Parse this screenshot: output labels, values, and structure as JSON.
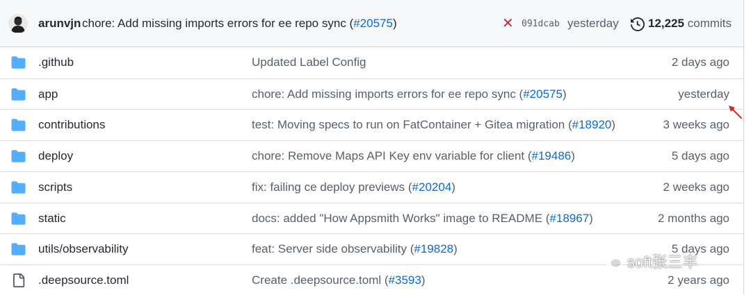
{
  "latest_commit": {
    "author": "arunvjn",
    "message": "chore: Add missing imports errors for ee repo sync (",
    "pr_link": "#20575",
    "message_close": ")",
    "status_icon": "x-icon",
    "status_symbol": "✕",
    "status_color": "#cf222e",
    "sha": "091dcab",
    "time": "yesterday",
    "history_icon": "history-icon",
    "commit_count": "12,225",
    "commit_word": "commits"
  },
  "files": [
    {
      "type": "folder",
      "name": ".github",
      "commit_text": "Updated Label Config",
      "commit_link": "",
      "commit_close": "",
      "time": "2 days ago"
    },
    {
      "type": "folder",
      "name": "app",
      "commit_text": "chore: Add missing imports errors for ee repo sync (",
      "commit_link": "#20575",
      "commit_close": ")",
      "time": "yesterday"
    },
    {
      "type": "folder",
      "name": "contributions",
      "commit_text": "test: Moving specs to run on FatContainer + Gitea migration (",
      "commit_link": "#18920",
      "commit_close": ")",
      "time": "3 weeks ago"
    },
    {
      "type": "folder",
      "name": "deploy",
      "commit_text": "chore: Remove Maps API Key env variable for client (",
      "commit_link": "#19486",
      "commit_close": ")",
      "time": "5 days ago"
    },
    {
      "type": "folder",
      "name": "scripts",
      "commit_text": "fix: failing ce deploy previews (",
      "commit_link": "#20204",
      "commit_close": ")",
      "time": "2 weeks ago"
    },
    {
      "type": "folder",
      "name": "static",
      "commit_text": "docs: added \"How Appsmith Works\" image to README (",
      "commit_link": "#18967",
      "commit_close": ")",
      "time": "2 months ago"
    },
    {
      "type": "folder",
      "name": "utils/observability",
      "commit_text": "feat: Server side observability (",
      "commit_link": "#19828",
      "commit_close": ")",
      "time": "5 days ago"
    },
    {
      "type": "file",
      "name": ".deepsource.toml",
      "commit_text": "Create .deepsource.toml (",
      "commit_link": "#3593",
      "commit_close": ")",
      "time": "2 years ago"
    }
  ],
  "watermark": {
    "text": "soft张三丰",
    "icon": "wechat-icon"
  },
  "colors": {
    "folder": "#54aeff",
    "link": "#0969da",
    "text": "#24292f",
    "muted": "#57606a",
    "annotation": "#e5231b"
  }
}
